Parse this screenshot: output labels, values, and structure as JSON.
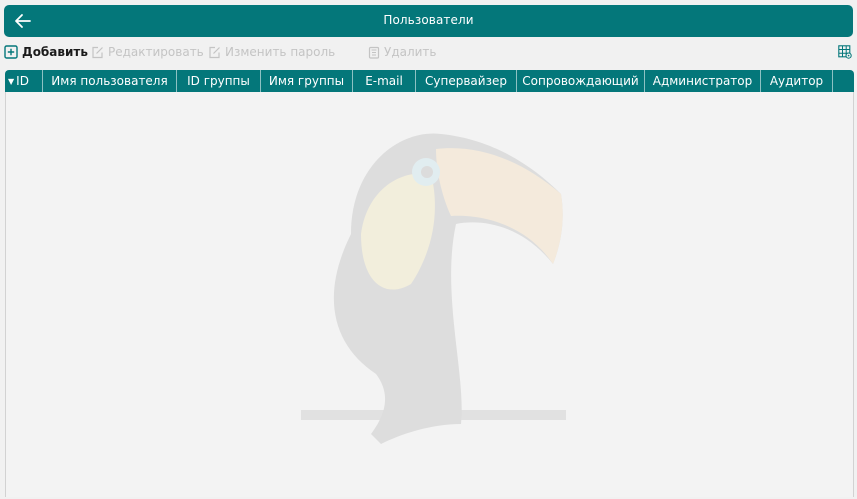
{
  "header": {
    "title": "Пользователи",
    "back_icon": "arrow-left-icon"
  },
  "toolbar": {
    "add": {
      "label": "Добавить",
      "icon": "plus-square-icon",
      "enabled": true
    },
    "edit": {
      "label": "Редактировать",
      "icon": "edit-icon",
      "enabled": false
    },
    "change_password": {
      "label": "Изменить пароль",
      "icon": "edit-icon",
      "enabled": false
    },
    "delete": {
      "label": "Удалить",
      "icon": "trash-icon",
      "enabled": false
    },
    "columns_icon": "table-settings-icon"
  },
  "table": {
    "columns": [
      {
        "label": "ID",
        "sorted": true
      },
      {
        "label": "Имя пользователя"
      },
      {
        "label": "ID группы"
      },
      {
        "label": "Имя группы"
      },
      {
        "label": "E-mail"
      },
      {
        "label": "Супервайзер"
      },
      {
        "label": "Сопровождающий"
      },
      {
        "label": "Администратор"
      },
      {
        "label": "Аудитор"
      }
    ],
    "rows": []
  },
  "colors": {
    "accent": "#04777a",
    "background": "#f1f1f1",
    "disabled_text": "#c4c4c4"
  }
}
